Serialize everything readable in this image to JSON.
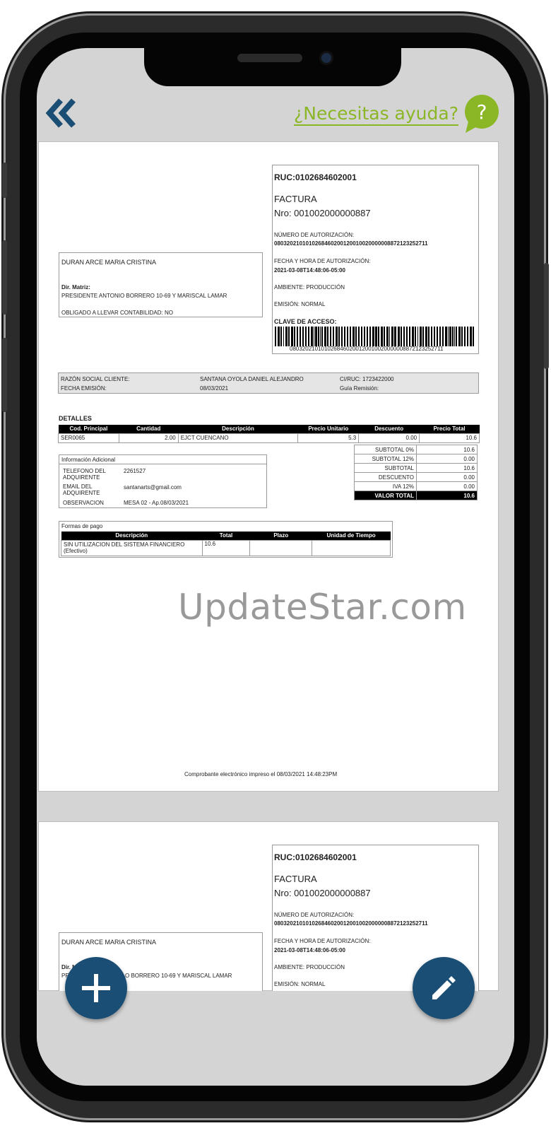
{
  "header": {
    "back_icon": "double-chevron-left-icon",
    "help_text": "¿Necesitas ayuda?",
    "help_icon": "question-bubble-icon",
    "accent_color": "#8bb626",
    "brand_color": "#1b4e74"
  },
  "invoice": {
    "ruc": "RUC:0102684602001",
    "doc_type": "FACTURA",
    "nro": "Nro: 001002000000887",
    "auth_label": "NÚMERO DE AUTORIZACIÓN:",
    "auth_number": "0803202101010268460200120010020000008872123252711",
    "auth_date_label": "FECHA Y HORA DE AUTORIZACIÓN:",
    "auth_date": "2021-03-08T14:48:06-05:00",
    "ambiente": "AMBIENTE: PRODUCCIÓN",
    "emision": "EMISIÓN: NORMAL",
    "clave_label": "CLAVE DE ACCESO:",
    "clave_number": "0803202101010268460200120010020000008872123252711",
    "issuer_name": "DURAN ARCE MARIA CRISTINA",
    "dir_label": "Dir. Matriz:",
    "dir_value": "PRESIDENTE ANTONIO BORRERO 10-69 Y MARISCAL LAMAR",
    "obligado": "OBLIGADO A LLEVAR CONTABILIDAD: NO",
    "client": {
      "razon_label": "RAZÓN SOCIAL CLIENTE:",
      "razon_value": "SANTANA OYOLA DANIEL ALEJANDRO",
      "ci_label": "CI/RUC: 1723422000",
      "fecha_label": "FECHA EMISIÓN:",
      "fecha_value": "08/03/2021",
      "guia_label": "Guía Remisión:"
    },
    "details_title": "DETALLES",
    "details_headers": [
      "Cod. Principal",
      "Cantidad",
      "Descripción",
      "Precio Unitario",
      "Descuento",
      "Precio Total"
    ],
    "details_row": [
      "SER0065",
      "2.00",
      "EJCT CUENCANO",
      "5.3",
      "0.00",
      "10.6"
    ],
    "totals": [
      {
        "label": "SUBTOTAL 0%",
        "value": "10.6"
      },
      {
        "label": "SUBTOTAL 12%",
        "value": "0.00"
      },
      {
        "label": "SUBTOTAL",
        "value": "10.6"
      },
      {
        "label": "DESCUENTO",
        "value": "0.00"
      },
      {
        "label": "IVA 12%",
        "value": "0.00"
      }
    ],
    "valor_total_label": "VALOR TOTAL",
    "valor_total": "10.6",
    "info_title": "Información Adicional",
    "info_rows": [
      {
        "label": "TELEFONO DEL ADQUIRENTE",
        "value": "2261527"
      },
      {
        "label": "EMAIL DEL ADQUIRENTE",
        "value": "santanarts@gmail.com"
      },
      {
        "label": "OBSERVACION",
        "value": "MESA 02 - Ap.08/03/2021"
      }
    ],
    "pago_title": "Formas de pago",
    "pago_headers": [
      "Descripción",
      "Total",
      "Plazo",
      "Unidad de Tiempo"
    ],
    "pago_row": [
      "SIN UTILIZACION DEL SISTEMA FINANCIERO (Efectivo)",
      "10.6",
      "",
      ""
    ],
    "footer": "Comprobante electrónico impreso el 08/03/2021 14:48:23PM"
  },
  "page2": {
    "ruc": "RUC:0102684602001",
    "doc_type": "FACTURA",
    "nro": "Nro: 001002000000887",
    "auth_label": "NÚMERO DE AUTORIZACIÓN:",
    "auth_number": "0803202101010268460200120010020000008872123252711",
    "auth_date_label": "FECHA Y HORA DE AUTORIZACIÓN:",
    "auth_date": "2021-03-08T14:48:06-05:00",
    "ambiente": "AMBIENTE: PRODUCCIÓN",
    "emision": "EMISIÓN: NORMAL",
    "issuer_name": "DURAN ARCE MARIA CRISTINA",
    "dir_label": "Dir. M",
    "dir_value_visible": "O BORRERO 10-69 Y MARISCAL LAMAR",
    "dir_value_prefix": "PRE"
  },
  "watermark": "UpdateStar.com",
  "fab": {
    "add_icon": "plus-icon",
    "edit_icon": "pencil-icon"
  }
}
